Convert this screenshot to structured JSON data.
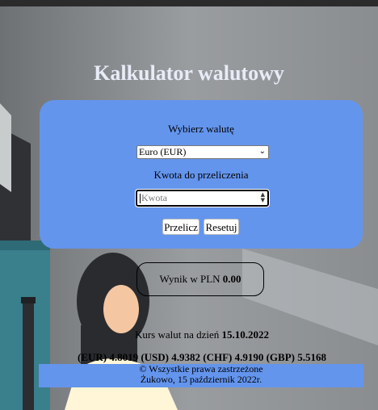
{
  "title": "Kalkulator walutowy",
  "calculator": {
    "currency_label": "Wybierz walutę",
    "currency_selected": "Euro (EUR)",
    "amount_label": "Kwota do przeliczenia",
    "amount_placeholder": "Kwota",
    "calc_button": "Przelicz",
    "reset_button": "Resetuj"
  },
  "result": {
    "label": "Wynik w PLN",
    "value": "0.00"
  },
  "rates": {
    "date_label": "Kurs walut na dzień",
    "date_value": "15.10.2022",
    "line": "(EUR) 4.8019 (USD) 4.9382 (CHF) 4.9190 (GBP) 5.5168"
  },
  "footer": {
    "copyright": "© Wszystkie prawa zastrzeżone",
    "location_date": "Żukowo, 15 październik 2022r."
  },
  "colors": {
    "panel": "#6495ed",
    "background": "#8c8f92"
  },
  "icons": {
    "select_chevron": "chevron-down-icon",
    "spinner": "spinner-arrows-icon"
  }
}
